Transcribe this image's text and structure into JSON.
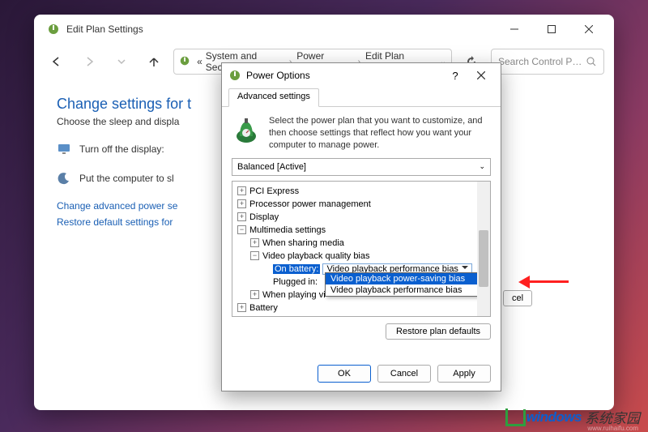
{
  "window": {
    "title": "Edit Plan Settings",
    "search_placeholder": "Search Control P…"
  },
  "breadcrumb": {
    "items": [
      "System and Security",
      "Power Options",
      "Edit Plan Settings"
    ]
  },
  "page": {
    "heading": "Change settings for t",
    "subheading": "Choose the sleep and displa",
    "row1_label": "Turn off the display:",
    "row2_label": "Put the computer to sl",
    "link1": "Change advanced power se",
    "link2": "Restore default settings for"
  },
  "dialog": {
    "title": "Power Options",
    "tab": "Advanced settings",
    "intro": "Select the power plan that you want to customize, and then choose settings that reflect how you want your computer to manage power.",
    "plan": "Balanced [Active]",
    "tree": {
      "pci": "PCI Express",
      "ppm": "Processor power management",
      "display": "Display",
      "multimedia": "Multimedia settings",
      "sharing": "When sharing media",
      "playback": "Video playback quality bias",
      "on_battery_label": "On battery:",
      "on_battery_value": "Video playback performance bias",
      "plugged_label": "Plugged in:",
      "playing_video": "When playing vi",
      "battery": "Battery"
    },
    "dropdown": {
      "opt1": "Video playback power-saving bias",
      "opt2": "Video playback performance bias"
    },
    "restore": "Restore plan defaults",
    "ok": "OK",
    "cancel": "Cancel",
    "apply": "Apply"
  },
  "ghost": {
    "cancel": "cel"
  },
  "watermark": {
    "brand": "windows",
    "suffix": "系统家园",
    "url": "www.ruihaifu.com"
  }
}
